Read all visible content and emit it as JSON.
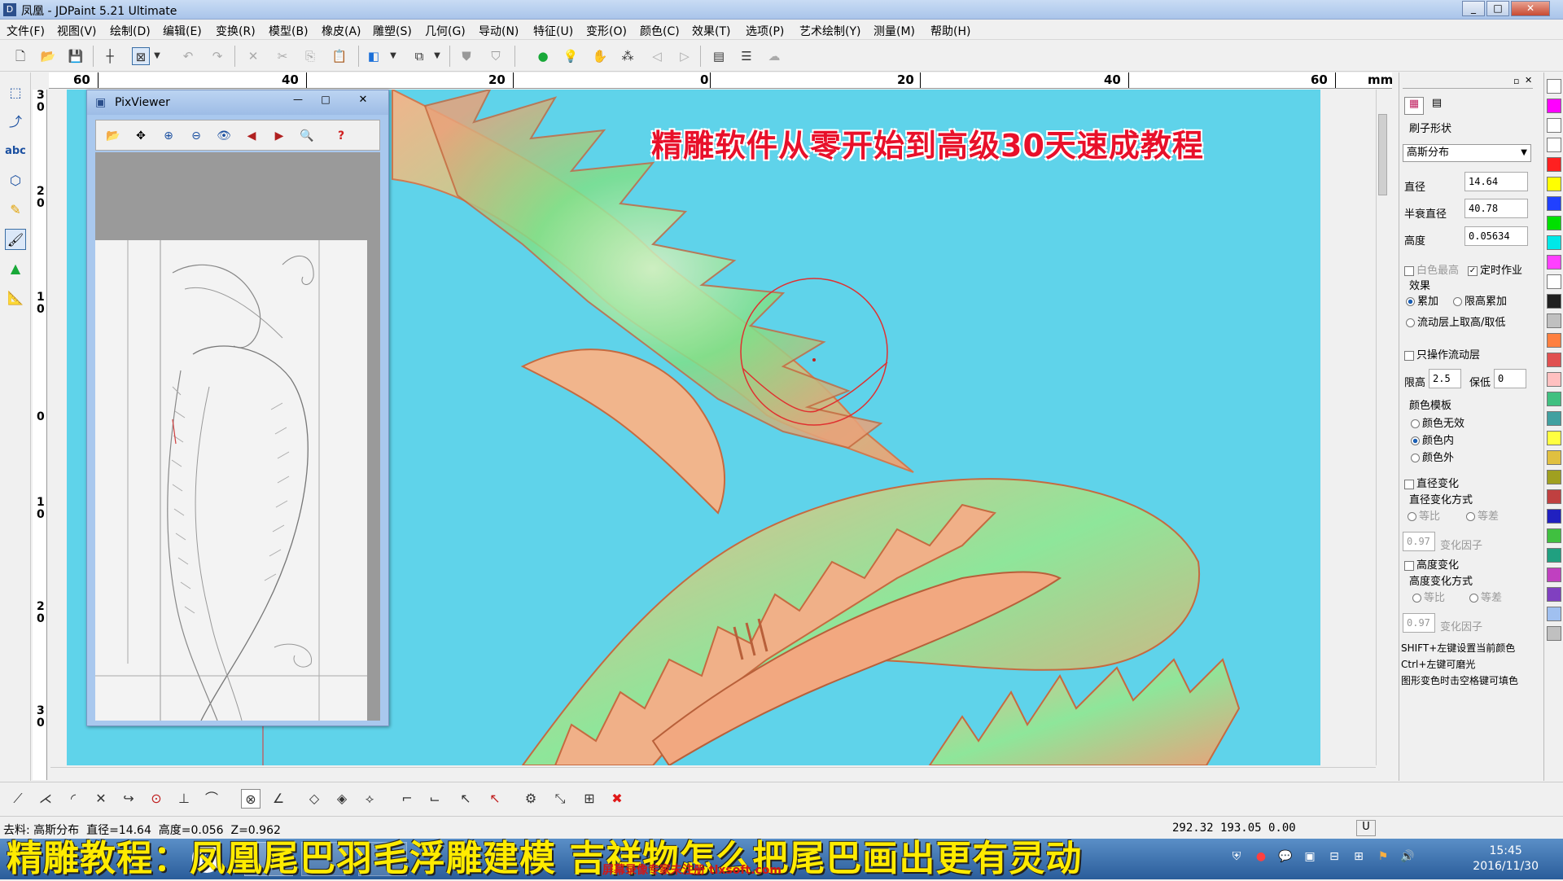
{
  "window": {
    "title": "凤凰 - JDPaint 5.21 Ultimate",
    "app_icon": "D"
  },
  "menu": [
    "文件(F)",
    "视图(V)",
    "绘制(D)",
    "编辑(E)",
    "变换(R)",
    "模型(B)",
    "橡皮(A)",
    "雕塑(S)",
    "几何(G)",
    "导动(N)",
    "特征(U)",
    "变形(O)",
    "颜色(C)",
    "效果(T)",
    "选项(P)",
    "艺术绘制(Y)",
    "测量(M)",
    "帮助(H)"
  ],
  "ruler_h": {
    "labels": [
      "60",
      "40",
      "20",
      "0",
      "20",
      "40",
      "60"
    ],
    "unit": "mm"
  },
  "ruler_v": {
    "labels": [
      "3\n0",
      "2\n0",
      "1\n0",
      "0",
      "1\n0",
      "2\n0",
      "3\n0"
    ]
  },
  "overlay_title": "精雕软件从零开始到高级30天速成教程",
  "pixviewer": {
    "title": "PixViewer"
  },
  "brush_panel": {
    "tab_label": "刷子形状",
    "brush_type": "高斯分布",
    "diameter_label": "直径",
    "diameter": "14.64",
    "half_decay_label": "半衰直径",
    "half_decay": "40.78",
    "height_label": "高度",
    "height": "0.05634",
    "white_max_label": "白色最高",
    "timed_label": "定时作业",
    "effect_label": "效果",
    "accumulate": "累加",
    "limit_accumulate": "限高累加",
    "flow_layer_label": "流动层上取高/取低",
    "only_flow_label": "只操作流动层",
    "limit_high_label": "限高",
    "limit_high": "2.5",
    "keep_low_label": "保低",
    "keep_low": "0",
    "color_template_label": "颜色模板",
    "color_none": "颜色无效",
    "color_in": "颜色内",
    "color_out": "颜色外",
    "diameter_change_label": "直径变化",
    "diameter_mode_label": "直径变化方式",
    "equal_ratio": "等比",
    "equal_diff": "等差",
    "factor_value": "0.97",
    "factor_label": "变化因子",
    "height_change_label": "高度变化",
    "height_mode_label": "高度变化方式",
    "hint1": "SHIFT+左键设置当前颜色",
    "hint2": "Ctrl+左键可磨光",
    "hint3": "图形变色时击空格键可填色"
  },
  "colors": [
    "#ffffff",
    "#ff00ff",
    "#ffffff",
    "#ffffff",
    "#ff2020",
    "#ffff00",
    "#2040ff",
    "#00e000",
    "#00e8e8",
    "#ff40ff",
    "#ffffff",
    "#202020",
    "#c0c0c0",
    "#ff8040",
    "#e05050",
    "#ffc0c0",
    "#40c080",
    "#40a0a0",
    "#ffff40",
    "#e0c040",
    "#a0a020",
    "#c04040",
    "#2020c0",
    "#40c040",
    "#20a080",
    "#c040c0",
    "#8040c0",
    "#a0c0f0",
    "#c0c0c0"
  ],
  "status": {
    "left": "去料: 高斯分布  直径=14.64  高度=0.056  Z=0.962",
    "coords": "292.32 193.05 0.00",
    "mode": "U"
  },
  "caption": "精雕教程：凤凰尾巴羽毛浮雕建模 吉祥物怎么把尾巴画出更有灵动",
  "watermark": "屏幕录像专家未注册 tlxsoft.com",
  "clock": {
    "time": "15:45",
    "date": "2016/11/30"
  }
}
